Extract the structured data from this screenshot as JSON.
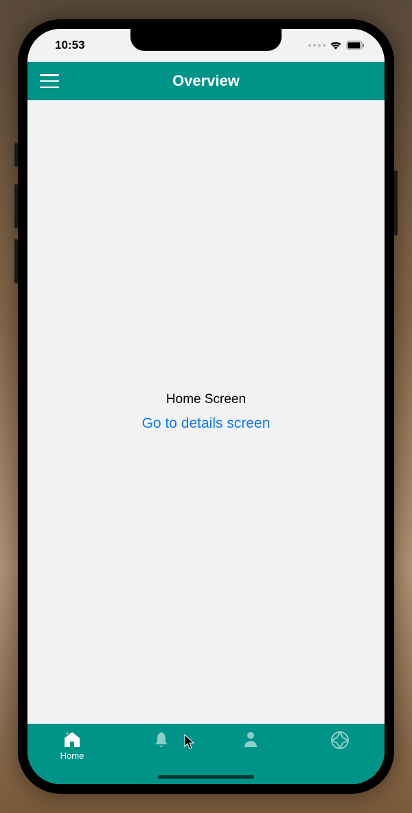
{
  "status": {
    "time": "10:53"
  },
  "header": {
    "title": "Overview"
  },
  "content": {
    "screen_label": "Home Screen",
    "details_link": "Go to details screen"
  },
  "tabs": {
    "home_label": "Home"
  },
  "colors": {
    "primary": "#009387",
    "link": "#0a7aff"
  }
}
